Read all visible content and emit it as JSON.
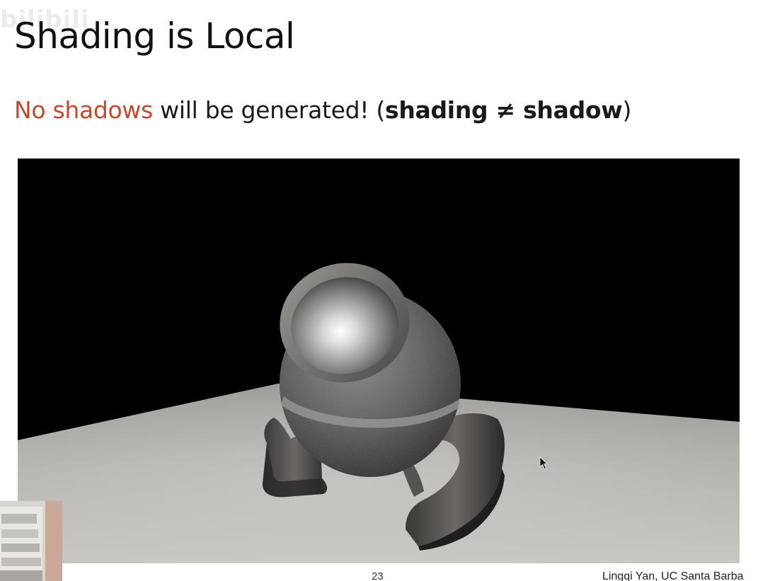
{
  "slide": {
    "title": "Shading is Local",
    "subtitle": {
      "highlight": "No shadows",
      "normal": " will be generated! (",
      "bold": "shading ≠ shadow",
      "close": ")"
    },
    "page_number": "23",
    "author": "Lingqi Yan, UC Santa Barba",
    "watermark": "bilibili"
  },
  "colors": {
    "highlight": "#c2492c",
    "text": "#1a1a1a",
    "render_background": "#000000",
    "floor": "#b9b7b3"
  },
  "icons": {
    "cursor": "mouse-pointer-icon"
  }
}
